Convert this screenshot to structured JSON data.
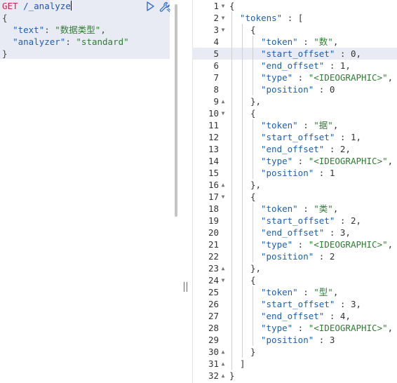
{
  "request": {
    "method": "GET",
    "endpoint": "/_analyze",
    "open_brace": "{",
    "close_brace": "}",
    "fields": [
      {
        "key": "\"text\"",
        "sep": ": ",
        "value": "\"数据类型\"",
        "trail": ","
      },
      {
        "key": "\"analyzer\"",
        "sep": ": ",
        "value": "\"standard\"",
        "trail": ""
      }
    ]
  },
  "toolbar": {
    "run_icon": "play-icon",
    "settings_icon": "wrench-icon"
  },
  "response": {
    "highlighted_line": 5,
    "lines": [
      {
        "n": "1",
        "fold": "▼",
        "text": "{"
      },
      {
        "n": "2",
        "fold": "▼",
        "key": "\"tokens\"",
        "sep": " : ",
        "text": "["
      },
      {
        "n": "3",
        "fold": "▼",
        "text": "{"
      },
      {
        "n": "4",
        "fold": "",
        "key": "\"token\"",
        "sep": " : ",
        "str": "\"数\"",
        "trail": ","
      },
      {
        "n": "5",
        "fold": "",
        "key": "\"start_offset\"",
        "sep": " : ",
        "num": "0",
        "trail": ","
      },
      {
        "n": "6",
        "fold": "",
        "key": "\"end_offset\"",
        "sep": " : ",
        "num": "1",
        "trail": ","
      },
      {
        "n": "7",
        "fold": "",
        "key": "\"type\"",
        "sep": " : ",
        "str": "\"<IDEOGRAPHIC>\"",
        "trail": ","
      },
      {
        "n": "8",
        "fold": "",
        "key": "\"position\"",
        "sep": " : ",
        "num": "0",
        "trail": ""
      },
      {
        "n": "9",
        "fold": "▲",
        "text": "},"
      },
      {
        "n": "10",
        "fold": "▼",
        "text": "{"
      },
      {
        "n": "11",
        "fold": "",
        "key": "\"token\"",
        "sep": " : ",
        "str": "\"据\"",
        "trail": ","
      },
      {
        "n": "12",
        "fold": "",
        "key": "\"start_offset\"",
        "sep": " : ",
        "num": "1",
        "trail": ","
      },
      {
        "n": "13",
        "fold": "",
        "key": "\"end_offset\"",
        "sep": " : ",
        "num": "2",
        "trail": ","
      },
      {
        "n": "14",
        "fold": "",
        "key": "\"type\"",
        "sep": " : ",
        "str": "\"<IDEOGRAPHIC>\"",
        "trail": ","
      },
      {
        "n": "15",
        "fold": "",
        "key": "\"position\"",
        "sep": " : ",
        "num": "1",
        "trail": ""
      },
      {
        "n": "16",
        "fold": "▲",
        "text": "},"
      },
      {
        "n": "17",
        "fold": "▼",
        "text": "{"
      },
      {
        "n": "18",
        "fold": "",
        "key": "\"token\"",
        "sep": " : ",
        "str": "\"类\"",
        "trail": ","
      },
      {
        "n": "19",
        "fold": "",
        "key": "\"start_offset\"",
        "sep": " : ",
        "num": "2",
        "trail": ","
      },
      {
        "n": "20",
        "fold": "",
        "key": "\"end_offset\"",
        "sep": " : ",
        "num": "3",
        "trail": ","
      },
      {
        "n": "21",
        "fold": "",
        "key": "\"type\"",
        "sep": " : ",
        "str": "\"<IDEOGRAPHIC>\"",
        "trail": ","
      },
      {
        "n": "22",
        "fold": "",
        "key": "\"position\"",
        "sep": " : ",
        "num": "2",
        "trail": ""
      },
      {
        "n": "23",
        "fold": "▲",
        "text": "},"
      },
      {
        "n": "24",
        "fold": "▼",
        "text": "{"
      },
      {
        "n": "25",
        "fold": "",
        "key": "\"token\"",
        "sep": " : ",
        "str": "\"型\"",
        "trail": ","
      },
      {
        "n": "26",
        "fold": "",
        "key": "\"start_offset\"",
        "sep": " : ",
        "num": "3",
        "trail": ","
      },
      {
        "n": "27",
        "fold": "",
        "key": "\"end_offset\"",
        "sep": " : ",
        "num": "4",
        "trail": ","
      },
      {
        "n": "28",
        "fold": "",
        "key": "\"type\"",
        "sep": " : ",
        "str": "\"<IDEOGRAPHIC>\"",
        "trail": ","
      },
      {
        "n": "29",
        "fold": "",
        "key": "\"position\"",
        "sep": " : ",
        "num": "3",
        "trail": ""
      },
      {
        "n": "30",
        "fold": "▲",
        "text": "}"
      },
      {
        "n": "31",
        "fold": "▲",
        "text": "]"
      },
      {
        "n": "32",
        "fold": "▲",
        "text": "}"
      }
    ]
  }
}
